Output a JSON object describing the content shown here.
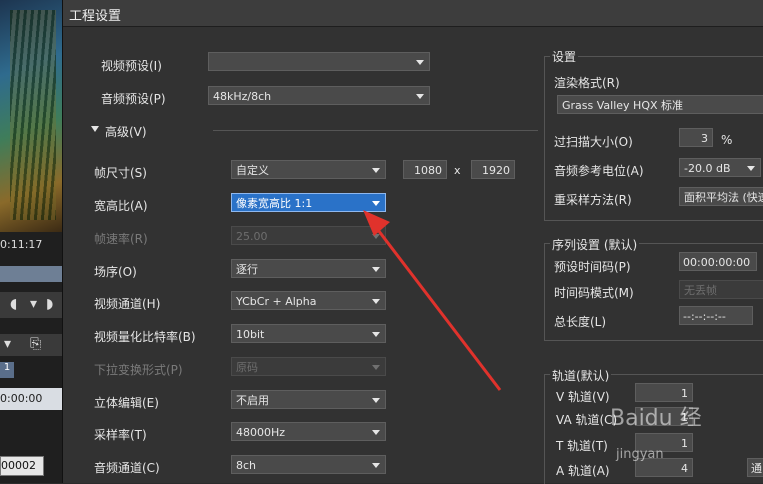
{
  "background_app": {
    "timecode": "0:11:17",
    "track_num": "1",
    "timecode2": "0:00:00",
    "clip_label": "00002"
  },
  "dialog": {
    "title": "工程设置",
    "video_preset": {
      "label": "视频预设(I)",
      "value": ""
    },
    "audio_preset": {
      "label": "音频预设(P)",
      "value": "48kHz/8ch"
    },
    "advanced": {
      "label": "高级(V)"
    },
    "frame_size": {
      "label": "帧尺寸(S)",
      "value": "自定义",
      "width": "1080",
      "x": "x",
      "height": "1920"
    },
    "aspect_ratio": {
      "label": "宽高比(A)",
      "value": "像素宽高比 1:1"
    },
    "frame_rate": {
      "label": "帧速率(R)",
      "value": "25.00"
    },
    "field_order": {
      "label": "场序(O)",
      "value": "逐行"
    },
    "video_channel": {
      "label": "视频通道(H)",
      "value": "YCbCr + Alpha"
    },
    "video_quant": {
      "label": "视频量化比特率(B)",
      "value": "10bit"
    },
    "pulldown": {
      "label": "下拉变换形式(P)",
      "value": "原码"
    },
    "stereo": {
      "label": "立体编辑(E)",
      "value": "不启用"
    },
    "sample_rate": {
      "label": "采样率(T)",
      "value": "48000Hz"
    },
    "audio_channel": {
      "label": "音频通道(C)",
      "value": "8ch"
    },
    "settings": {
      "title": "设置",
      "render_format": {
        "label": "渲染格式(R)",
        "value": "Grass Valley HQX 标准"
      },
      "overscan": {
        "label": "过扫描大小(O)",
        "value": "3",
        "unit": "%"
      },
      "audio_ref": {
        "label": "音频参考电位(A)",
        "value": "-20.0 dB"
      },
      "resample": {
        "label": "重采样方法(R)",
        "value": "面积平均法 (快速)"
      }
    },
    "sequence": {
      "title": "序列设置 (默认)",
      "preset_tc": {
        "label": "预设时间码(P)",
        "value": "00:00:00:00"
      },
      "tc_mode": {
        "label": "时间码模式(M)",
        "value": "无丢帧"
      },
      "total_len": {
        "label": "总长度(L)",
        "value": "--:--:--:--"
      }
    },
    "tracks": {
      "title": "轨道(默认)",
      "v": {
        "label": "V 轨道(V)",
        "value": "1"
      },
      "va": {
        "label": "VA 轨道(C)",
        "value": "1"
      },
      "t": {
        "label": "T 轨道(T)",
        "value": "1"
      },
      "a": {
        "label": "A 轨道(A)",
        "value": "4"
      },
      "btn": "通"
    }
  },
  "watermark": {
    "text": "Baidu 经",
    "small": "jingyan"
  }
}
